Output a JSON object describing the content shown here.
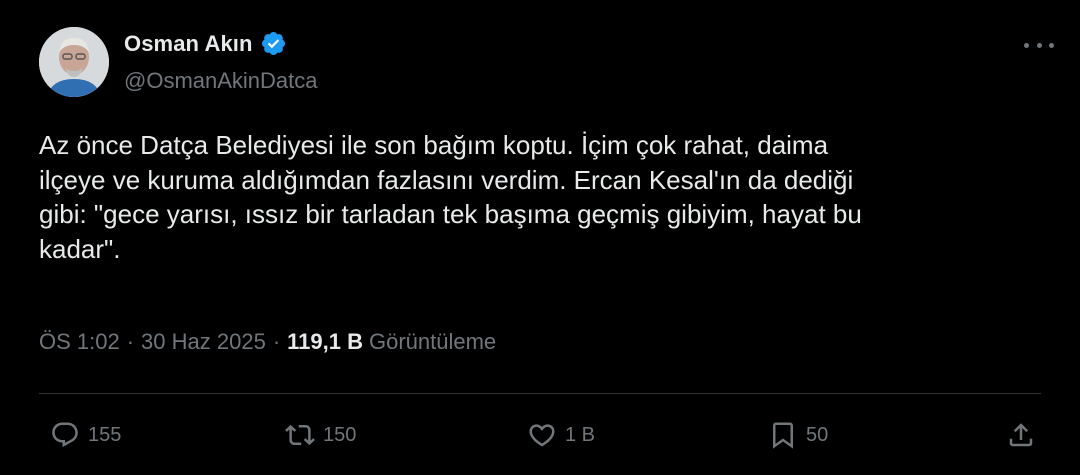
{
  "user": {
    "display_name": "Osman Akın",
    "handle": "@OsmanAkinDatca",
    "avatar_icon": "profile-photo",
    "verified_icon": "verified-badge-icon",
    "verified_color": "#1d9bf0"
  },
  "tweet": {
    "text": "Az önce Datça Belediyesi ile son bağım koptu. İçim çok rahat, daima\nilçeye ve kuruma aldığımdan fazlasını verdim. Ercan Kesal'ın da dediği\ngibi: \"gece yarısı, ıssız bir tarladan tek başıma geçmiş gibiyim, hayat bu\nkadar\"."
  },
  "meta": {
    "time": "ÖS 1:02",
    "separator": "·",
    "date": "30 Haz 2025",
    "views_count": "119,1 B",
    "views_label": "Görüntüleme"
  },
  "actions": {
    "replies": "155",
    "reposts": "150",
    "likes": "1 B",
    "bookmarks": "50"
  },
  "colors": {
    "background": "#000000",
    "text": "#e7e9ea",
    "muted": "#71767b",
    "divider": "#2f3336"
  }
}
